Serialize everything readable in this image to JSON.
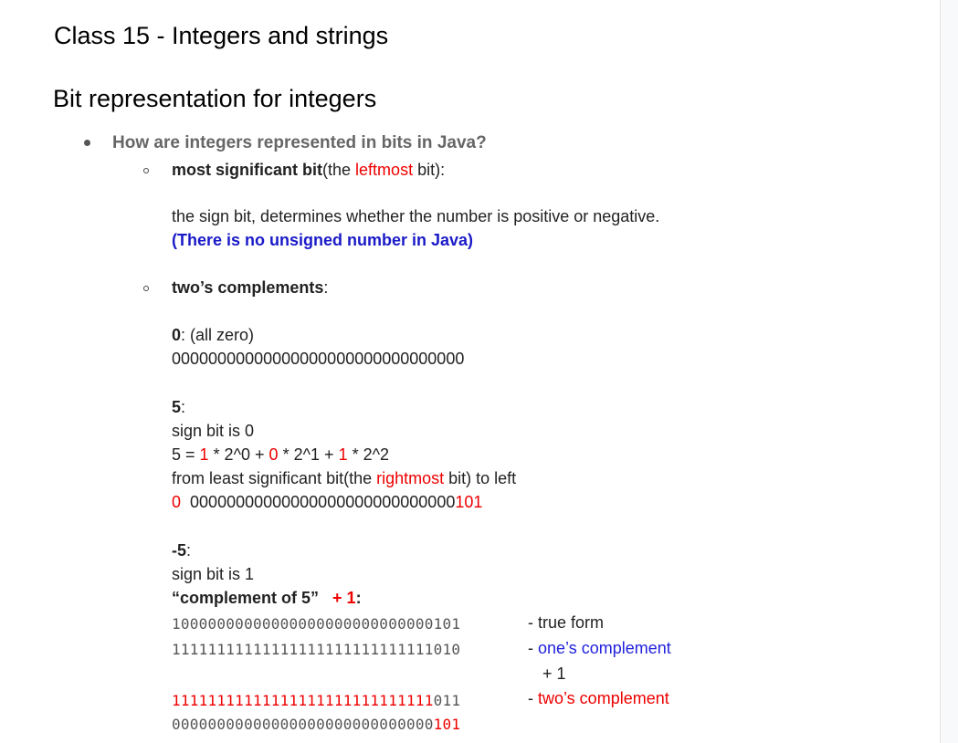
{
  "title": "Class 15 - Integers and strings",
  "heading": "Bit representation for integers",
  "question": "How are integers represented in bits in Java?",
  "msb": {
    "label": "most significant bit",
    "paren_open": "(the ",
    "paren_red": "leftmost",
    "paren_close": " bit):",
    "desc": "the sign bit, determines whether the number is positive or negative.",
    "note": "(There is no unsigned number in Java)"
  },
  "twos": {
    "label": "two’s complements",
    "colon": ":"
  },
  "zero": {
    "label": "0",
    "rest": ": (all zero)",
    "bits": "00000000000000000000000000000000"
  },
  "five": {
    "label": "5",
    "colon": ":",
    "sign": "sign bit is 0",
    "eq_start": "5 = ",
    "c1": "1",
    "t1": " * 2^0 + ",
    "c2": "0",
    "t2": " * 2^1 + ",
    "c3": "1",
    "t3": " * 2^2",
    "from_start": "from least significant bit(the ",
    "from_red": "rightmost",
    "from_end": " bit) to left",
    "bits_sign": "0",
    "bits_mid": "00000000000000000000000000000",
    "bits_tail": "101"
  },
  "neg5": {
    "label": "-5",
    "colon": ":",
    "sign": "sign bit is 1",
    "comp_label": "“complement of 5”",
    "plus_one": "+ 1",
    "comp_colon": ":",
    "row1": {
      "bits": "10000000000000000000000000000101",
      "label": "- true form"
    },
    "row2": {
      "bits": "11111111111111111111111111111010",
      "dash": "- ",
      "label": "one’s complement"
    },
    "plus": "+ 1",
    "row3": {
      "bits_red": "11111111111111111111111111111",
      "bits_gray": "011",
      "dash": "- ",
      "label": "two’s complement"
    },
    "row4": {
      "bits_gray": "00000000000000000000000000000",
      "bits_red": "101"
    }
  }
}
